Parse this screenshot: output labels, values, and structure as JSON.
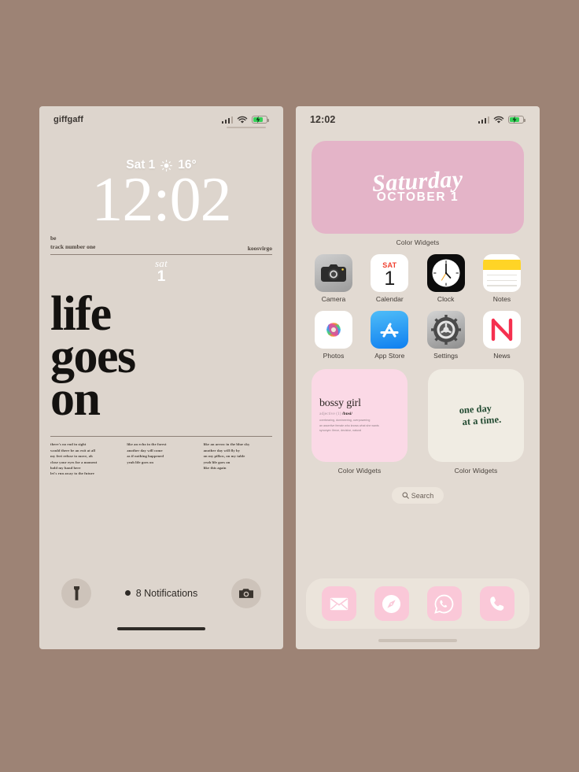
{
  "colors": {
    "page_background": "#9d8375",
    "lock_screen_background": "#ddd5cd",
    "home_screen_background": "#e2dad2",
    "pink_widget": "#e4b4c8",
    "bossy_widget": "#fbd9e6",
    "oneday_widget": "#f0ece3",
    "dock": "#ebe4db",
    "dock_icon": "#fac8d8",
    "battery_green": "#35d158",
    "calendar_red": "#f0402f",
    "notes_yellow": "#ffd426",
    "oneday_green": "#234b32"
  },
  "lock_screen": {
    "status": {
      "carrier": "giffgaff",
      "signal_icon": "cellular-bars-icon",
      "wifi_icon": "wifi-icon",
      "battery_icon": "battery-charging-icon"
    },
    "date_line": "Sat 1",
    "weather_icon": "sun-icon",
    "temperature": "16°",
    "time": "12:02",
    "music_widget": {
      "line1": "be",
      "line2": "track number one",
      "artist": "koosvirgo"
    },
    "date_widget": {
      "weekday": "sat",
      "day": "1"
    },
    "headline": {
      "line1": "life",
      "line2": "goes",
      "line3": "on"
    },
    "verses": [
      {
        "lines": [
          "there's no end in sight",
          "would there be an exit at all",
          "my feet refuse to move, oh",
          "close your eyes for a moment",
          "hold my hand here",
          "let's run away to the future"
        ]
      },
      {
        "lines": [
          "like an echo in the forest",
          "another day will come",
          "as if nothing happened",
          "yeah life goes on"
        ]
      },
      {
        "lines": [
          "like an arrow in the blue sky",
          "another day will fly by",
          "on my pillow, on my table",
          "yeah life goes on",
          "like this again"
        ]
      }
    ],
    "bottom": {
      "flashlight_icon": "flashlight-icon",
      "camera_icon": "camera-icon",
      "notifications_text": "8 Notifications"
    }
  },
  "home_screen": {
    "status": {
      "clock": "12:02",
      "signal_icon": "cellular-bars-icon",
      "wifi_icon": "wifi-icon",
      "battery_icon": "battery-charging-icon"
    },
    "top_widget": {
      "script_text": "Saturday",
      "month_line": "OCTOBER 1",
      "caption": "Color Widgets"
    },
    "apps_row1": [
      {
        "label": "Camera",
        "icon": "camera-app-icon"
      },
      {
        "label": "Calendar",
        "icon": "calendar-app-icon",
        "weekday": "SAT",
        "day": "1"
      },
      {
        "label": "Clock",
        "icon": "clock-app-icon"
      },
      {
        "label": "Notes",
        "icon": "notes-app-icon"
      }
    ],
    "apps_row2": [
      {
        "label": "Photos",
        "icon": "photos-app-icon"
      },
      {
        "label": "App Store",
        "icon": "appstore-app-icon"
      },
      {
        "label": "Settings",
        "icon": "settings-app-icon"
      },
      {
        "label": "News",
        "icon": "news-app-icon"
      }
    ],
    "widget_bossy": {
      "title": "bossy girl",
      "adjective_label": "adjective (1)",
      "pronunciation": "/bɒsi/",
      "definition_lines": [
        "overbearing, domineering, overpowering",
        "an assertive female who knows what she wants",
        "synonym: fierce, decisive, natural"
      ],
      "caption": "Color Widgets"
    },
    "widget_oneday": {
      "line1": "one day",
      "line2": "at a time.",
      "caption": "Color Widgets"
    },
    "search": {
      "label": "Search",
      "icon": "search-icon"
    },
    "dock": [
      {
        "name": "Mail",
        "icon": "mail-icon"
      },
      {
        "name": "Safari",
        "icon": "safari-compass-icon"
      },
      {
        "name": "WhatsApp",
        "icon": "whatsapp-icon"
      },
      {
        "name": "Phone",
        "icon": "phone-icon"
      }
    ]
  }
}
